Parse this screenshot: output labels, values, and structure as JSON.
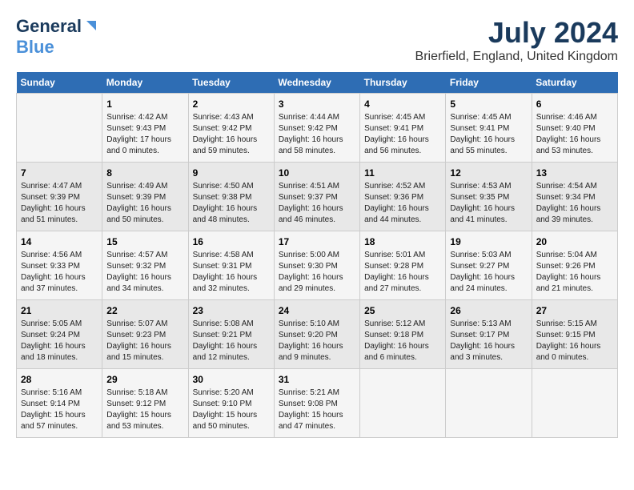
{
  "logo": {
    "part1": "General",
    "part2": "Blue"
  },
  "title": "July 2024",
  "subtitle": "Brierfield, England, United Kingdom",
  "days_header": [
    "Sunday",
    "Monday",
    "Tuesday",
    "Wednesday",
    "Thursday",
    "Friday",
    "Saturday"
  ],
  "weeks": [
    [
      {
        "day": "",
        "info": ""
      },
      {
        "day": "1",
        "info": "Sunrise: 4:42 AM\nSunset: 9:43 PM\nDaylight: 17 hours\nand 0 minutes."
      },
      {
        "day": "2",
        "info": "Sunrise: 4:43 AM\nSunset: 9:42 PM\nDaylight: 16 hours\nand 59 minutes."
      },
      {
        "day": "3",
        "info": "Sunrise: 4:44 AM\nSunset: 9:42 PM\nDaylight: 16 hours\nand 58 minutes."
      },
      {
        "day": "4",
        "info": "Sunrise: 4:45 AM\nSunset: 9:41 PM\nDaylight: 16 hours\nand 56 minutes."
      },
      {
        "day": "5",
        "info": "Sunrise: 4:45 AM\nSunset: 9:41 PM\nDaylight: 16 hours\nand 55 minutes."
      },
      {
        "day": "6",
        "info": "Sunrise: 4:46 AM\nSunset: 9:40 PM\nDaylight: 16 hours\nand 53 minutes."
      }
    ],
    [
      {
        "day": "7",
        "info": "Sunrise: 4:47 AM\nSunset: 9:39 PM\nDaylight: 16 hours\nand 51 minutes."
      },
      {
        "day": "8",
        "info": "Sunrise: 4:49 AM\nSunset: 9:39 PM\nDaylight: 16 hours\nand 50 minutes."
      },
      {
        "day": "9",
        "info": "Sunrise: 4:50 AM\nSunset: 9:38 PM\nDaylight: 16 hours\nand 48 minutes."
      },
      {
        "day": "10",
        "info": "Sunrise: 4:51 AM\nSunset: 9:37 PM\nDaylight: 16 hours\nand 46 minutes."
      },
      {
        "day": "11",
        "info": "Sunrise: 4:52 AM\nSunset: 9:36 PM\nDaylight: 16 hours\nand 44 minutes."
      },
      {
        "day": "12",
        "info": "Sunrise: 4:53 AM\nSunset: 9:35 PM\nDaylight: 16 hours\nand 41 minutes."
      },
      {
        "day": "13",
        "info": "Sunrise: 4:54 AM\nSunset: 9:34 PM\nDaylight: 16 hours\nand 39 minutes."
      }
    ],
    [
      {
        "day": "14",
        "info": "Sunrise: 4:56 AM\nSunset: 9:33 PM\nDaylight: 16 hours\nand 37 minutes."
      },
      {
        "day": "15",
        "info": "Sunrise: 4:57 AM\nSunset: 9:32 PM\nDaylight: 16 hours\nand 34 minutes."
      },
      {
        "day": "16",
        "info": "Sunrise: 4:58 AM\nSunset: 9:31 PM\nDaylight: 16 hours\nand 32 minutes."
      },
      {
        "day": "17",
        "info": "Sunrise: 5:00 AM\nSunset: 9:30 PM\nDaylight: 16 hours\nand 29 minutes."
      },
      {
        "day": "18",
        "info": "Sunrise: 5:01 AM\nSunset: 9:28 PM\nDaylight: 16 hours\nand 27 minutes."
      },
      {
        "day": "19",
        "info": "Sunrise: 5:03 AM\nSunset: 9:27 PM\nDaylight: 16 hours\nand 24 minutes."
      },
      {
        "day": "20",
        "info": "Sunrise: 5:04 AM\nSunset: 9:26 PM\nDaylight: 16 hours\nand 21 minutes."
      }
    ],
    [
      {
        "day": "21",
        "info": "Sunrise: 5:05 AM\nSunset: 9:24 PM\nDaylight: 16 hours\nand 18 minutes."
      },
      {
        "day": "22",
        "info": "Sunrise: 5:07 AM\nSunset: 9:23 PM\nDaylight: 16 hours\nand 15 minutes."
      },
      {
        "day": "23",
        "info": "Sunrise: 5:08 AM\nSunset: 9:21 PM\nDaylight: 16 hours\nand 12 minutes."
      },
      {
        "day": "24",
        "info": "Sunrise: 5:10 AM\nSunset: 9:20 PM\nDaylight: 16 hours\nand 9 minutes."
      },
      {
        "day": "25",
        "info": "Sunrise: 5:12 AM\nSunset: 9:18 PM\nDaylight: 16 hours\nand 6 minutes."
      },
      {
        "day": "26",
        "info": "Sunrise: 5:13 AM\nSunset: 9:17 PM\nDaylight: 16 hours\nand 3 minutes."
      },
      {
        "day": "27",
        "info": "Sunrise: 5:15 AM\nSunset: 9:15 PM\nDaylight: 16 hours\nand 0 minutes."
      }
    ],
    [
      {
        "day": "28",
        "info": "Sunrise: 5:16 AM\nSunset: 9:14 PM\nDaylight: 15 hours\nand 57 minutes."
      },
      {
        "day": "29",
        "info": "Sunrise: 5:18 AM\nSunset: 9:12 PM\nDaylight: 15 hours\nand 53 minutes."
      },
      {
        "day": "30",
        "info": "Sunrise: 5:20 AM\nSunset: 9:10 PM\nDaylight: 15 hours\nand 50 minutes."
      },
      {
        "day": "31",
        "info": "Sunrise: 5:21 AM\nSunset: 9:08 PM\nDaylight: 15 hours\nand 47 minutes."
      },
      {
        "day": "",
        "info": ""
      },
      {
        "day": "",
        "info": ""
      },
      {
        "day": "",
        "info": ""
      }
    ]
  ]
}
